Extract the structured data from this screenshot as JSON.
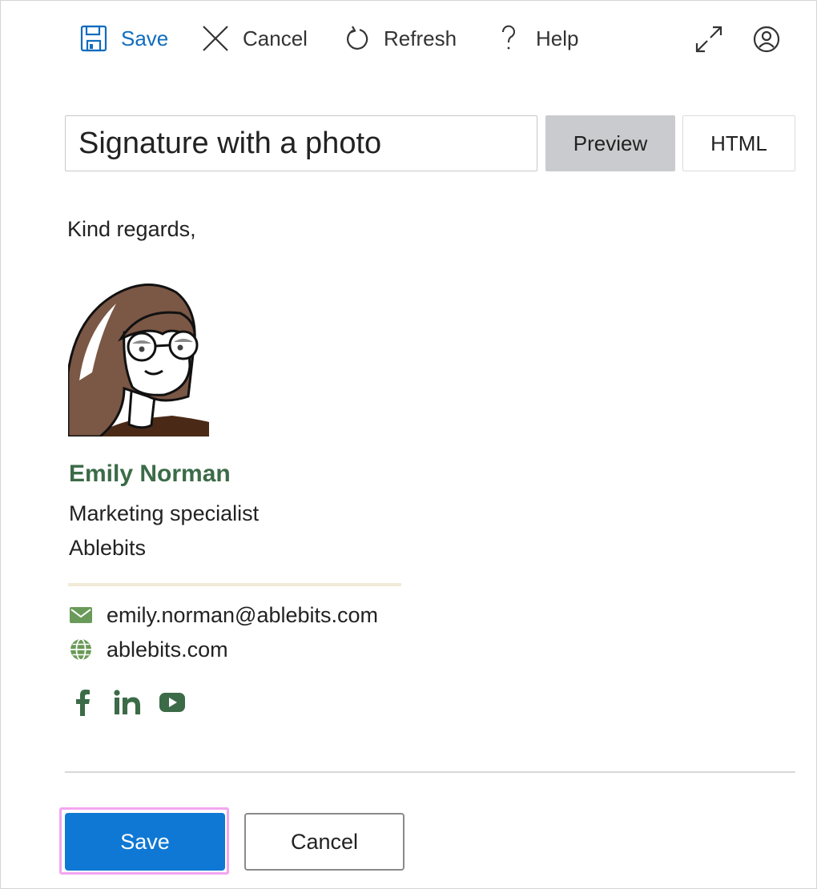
{
  "toolbar": {
    "save_label": "Save",
    "cancel_label": "Cancel",
    "refresh_label": "Refresh",
    "help_label": "Help",
    "icons": {
      "save": "save-icon",
      "cancel": "close-icon",
      "refresh": "refresh-icon",
      "help": "help-icon",
      "expand": "expand-icon",
      "account": "user-icon"
    }
  },
  "signature": {
    "name_value": "Signature with a photo",
    "view_tabs": [
      {
        "label": "Preview",
        "selected": true
      },
      {
        "label": "HTML",
        "selected": false
      }
    ]
  },
  "preview": {
    "greeting": "Kind regards,",
    "name": "Emily Norman",
    "title": "Marketing specialist",
    "company": "Ablebits",
    "email": "emily.norman@ablebits.com",
    "website": "ablebits.com",
    "social": [
      "facebook-icon",
      "linkedin-icon",
      "youtube-icon"
    ]
  },
  "footer": {
    "save_label": "Save",
    "cancel_label": "Cancel"
  },
  "colors": {
    "accent": "#0f78d4",
    "toolbar_save": "#0f6cbd",
    "signature_green": "#3b6b47",
    "icon_green": "#6a9a59",
    "focus_ring": "#f3a6f0"
  }
}
